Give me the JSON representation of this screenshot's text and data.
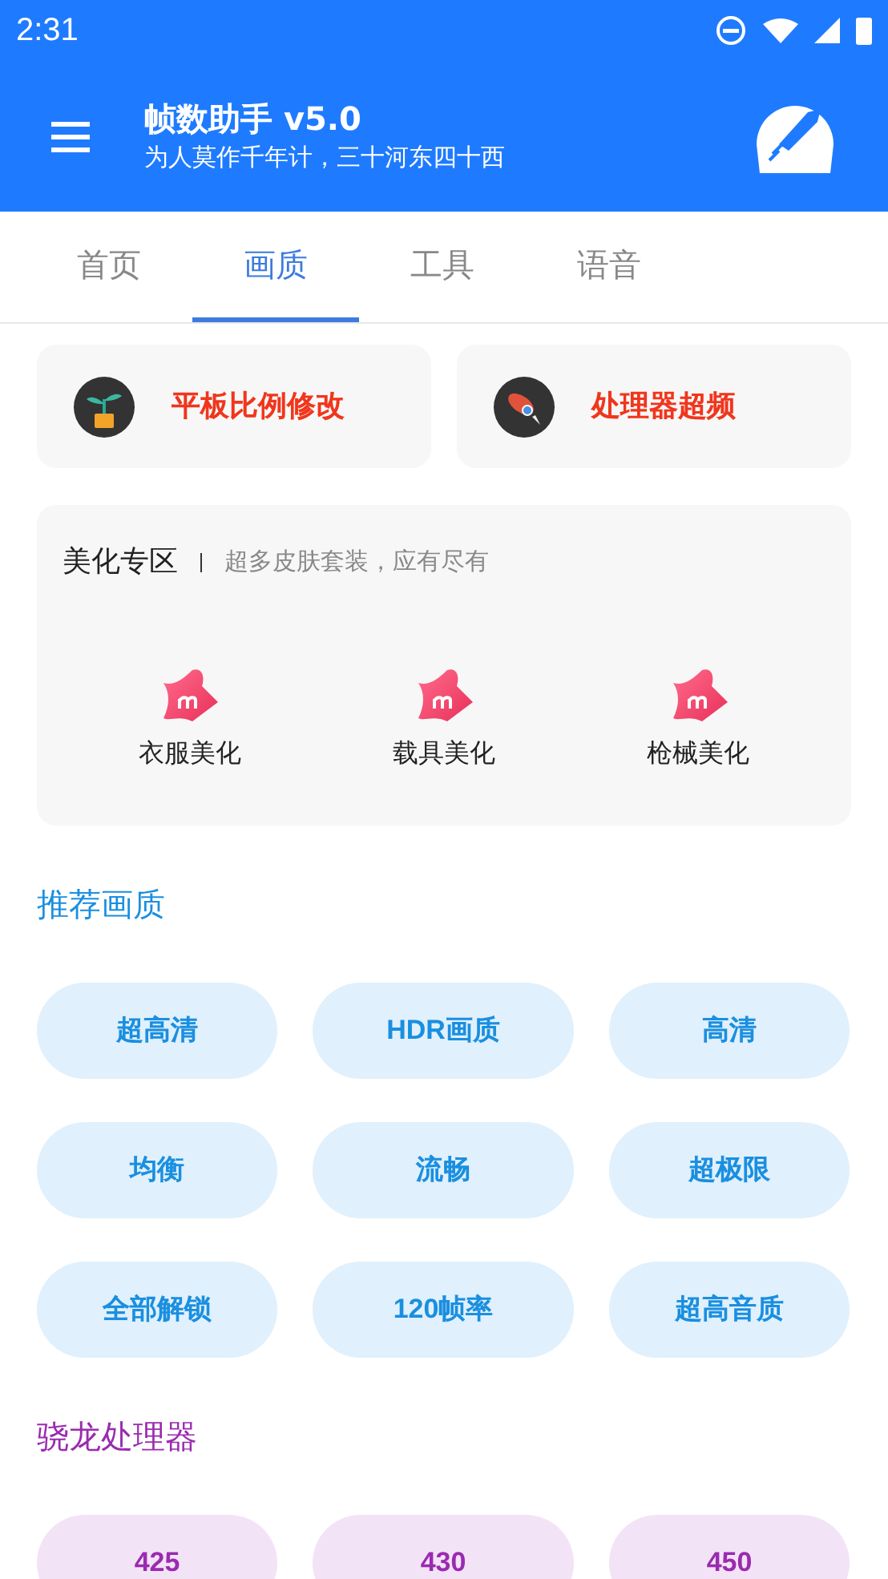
{
  "status_bar": {
    "time": "2:31"
  },
  "app_bar": {
    "title": "帧数助手 v5.0",
    "subtitle": "为人莫作千年计，三十河东四十西"
  },
  "tabs": [
    {
      "label": "首页",
      "selected": false
    },
    {
      "label": "画质",
      "selected": true
    },
    {
      "label": "工具",
      "selected": false
    },
    {
      "label": "语音",
      "selected": false
    }
  ],
  "feature_cards": [
    {
      "label": "平板比例修改",
      "kind": "plant"
    },
    {
      "label": "处理器超频",
      "kind": "rocket"
    }
  ],
  "beauty_section": {
    "title": "美化专区",
    "subtitle": "超多皮肤套装，应有尽有",
    "items": [
      {
        "label": "衣服美化"
      },
      {
        "label": "载具美化"
      },
      {
        "label": "枪械美化"
      }
    ]
  },
  "sections": [
    {
      "title": "推荐画质",
      "kind": "blue",
      "buttons": [
        "超高清",
        "HDR画质",
        "高清",
        "均衡",
        "流畅",
        "超极限",
        "全部解锁",
        "120帧率",
        "超高音质"
      ]
    },
    {
      "title": "骁龙处理器",
      "kind": "purple",
      "buttons": [
        "425",
        "430",
        "450"
      ]
    }
  ]
}
